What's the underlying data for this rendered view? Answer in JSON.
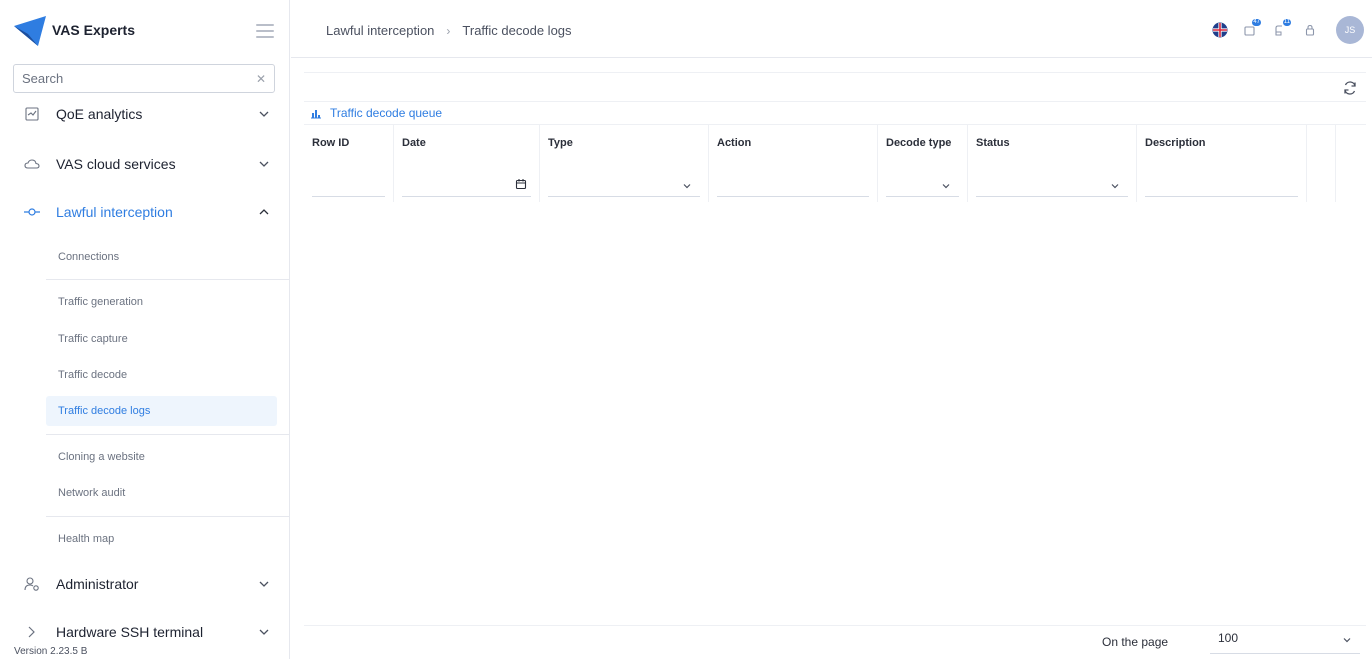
{
  "app": {
    "brand": "VAS Experts",
    "version": "Version 2.23.5 B"
  },
  "sidebar": {
    "search_placeholder": "Search",
    "items": [
      {
        "label": "QoE analytics",
        "icon": "chart-box-icon"
      },
      {
        "label": "VAS cloud services",
        "icon": "cloud-icon"
      },
      {
        "label": "Lawful interception",
        "icon": "node-icon",
        "expanded": true
      },
      {
        "label": "Administrator",
        "icon": "admin-user-icon"
      },
      {
        "label": "Hardware SSH terminal",
        "icon": "terminal-icon"
      }
    ],
    "subitems": [
      "Connections",
      "Traffic generation",
      "Traffic capture",
      "Traffic decode",
      "Traffic decode logs",
      "Cloning a website",
      "Network audit",
      "Health map"
    ],
    "selected_subitem": "Traffic decode logs"
  },
  "header": {
    "breadcrumb": [
      "Lawful interception",
      "Traffic decode logs"
    ],
    "avatar_initials": "JS",
    "badges": {
      "notifications": "47",
      "tasks": "11"
    }
  },
  "main": {
    "tab_label": "Traffic decode queue",
    "columns": [
      "Row ID",
      "Date",
      "Type",
      "Action",
      "Decode type",
      "Status",
      "Description"
    ],
    "footer": {
      "on_page_label": "On the page",
      "page_size": "100"
    }
  },
  "colors": {
    "accent": "#2f7de1",
    "selected_bg": "#eef5fd",
    "avatar": "#a9b7d6"
  }
}
